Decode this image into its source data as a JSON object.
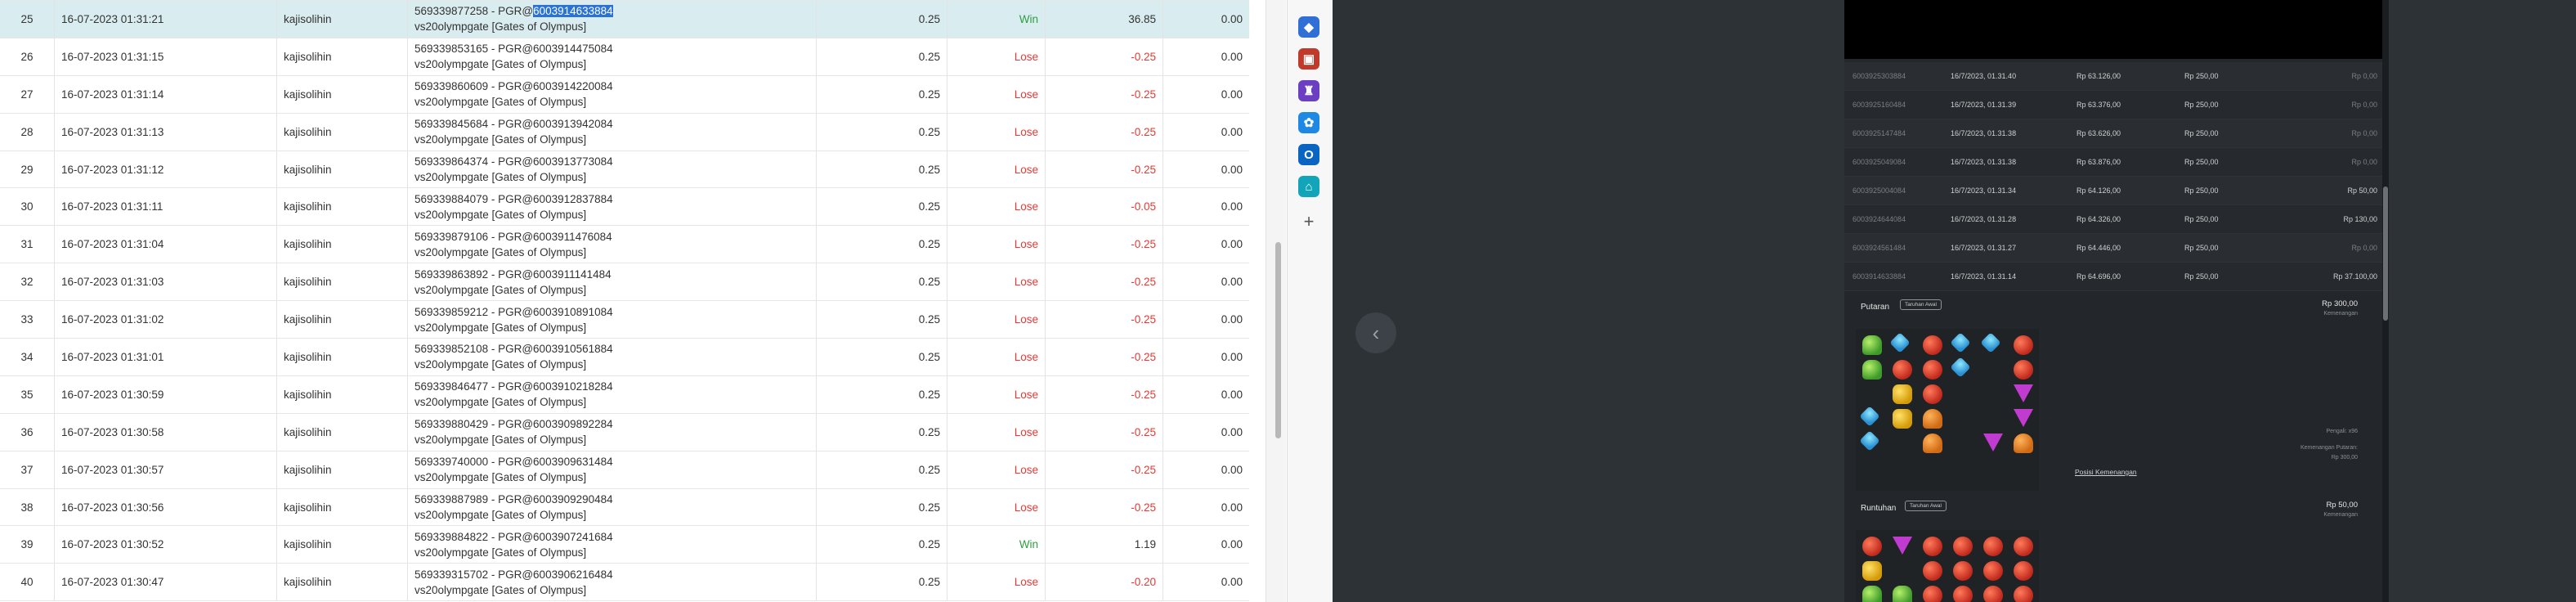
{
  "rows": [
    {
      "no": "25",
      "date": "16-07-2023 01:31:21",
      "user": "kajisolihin",
      "desc_a": "569339877258 - PGR@",
      "desc_sel": "6003914633884",
      "desc_b": "vs20olympgate [Gates of Olympus]",
      "bet": "0.25",
      "result": "Win",
      "winlose": "36.85",
      "balance": "0.00"
    },
    {
      "no": "26",
      "date": "16-07-2023 01:31:15",
      "user": "kajisolihin",
      "desc_a": "569339853165 - PGR@6003914475084",
      "desc_sel": "",
      "desc_b": "vs20olympgate [Gates of Olympus]",
      "bet": "0.25",
      "result": "Lose",
      "winlose": "-0.25",
      "balance": "0.00"
    },
    {
      "no": "27",
      "date": "16-07-2023 01:31:14",
      "user": "kajisolihin",
      "desc_a": "569339860609 - PGR@6003914220084",
      "desc_sel": "",
      "desc_b": "vs20olympgate [Gates of Olympus]",
      "bet": "0.25",
      "result": "Lose",
      "winlose": "-0.25",
      "balance": "0.00"
    },
    {
      "no": "28",
      "date": "16-07-2023 01:31:13",
      "user": "kajisolihin",
      "desc_a": "569339845684 - PGR@6003913942084",
      "desc_sel": "",
      "desc_b": "vs20olympgate [Gates of Olympus]",
      "bet": "0.25",
      "result": "Lose",
      "winlose": "-0.25",
      "balance": "0.00"
    },
    {
      "no": "29",
      "date": "16-07-2023 01:31:12",
      "user": "kajisolihin",
      "desc_a": "569339864374 - PGR@6003913773084",
      "desc_sel": "",
      "desc_b": "vs20olympgate [Gates of Olympus]",
      "bet": "0.25",
      "result": "Lose",
      "winlose": "-0.25",
      "balance": "0.00"
    },
    {
      "no": "30",
      "date": "16-07-2023 01:31:11",
      "user": "kajisolihin",
      "desc_a": "569339884079 - PGR@6003912837884",
      "desc_sel": "",
      "desc_b": "vs20olympgate [Gates of Olympus]",
      "bet": "0.25",
      "result": "Lose",
      "winlose": "-0.05",
      "balance": "0.00"
    },
    {
      "no": "31",
      "date": "16-07-2023 01:31:04",
      "user": "kajisolihin",
      "desc_a": "569339879106 - PGR@6003911476084",
      "desc_sel": "",
      "desc_b": "vs20olympgate [Gates of Olympus]",
      "bet": "0.25",
      "result": "Lose",
      "winlose": "-0.25",
      "balance": "0.00"
    },
    {
      "no": "32",
      "date": "16-07-2023 01:31:03",
      "user": "kajisolihin",
      "desc_a": "569339863892 - PGR@6003911141484",
      "desc_sel": "",
      "desc_b": "vs20olympgate [Gates of Olympus]",
      "bet": "0.25",
      "result": "Lose",
      "winlose": "-0.25",
      "balance": "0.00"
    },
    {
      "no": "33",
      "date": "16-07-2023 01:31:02",
      "user": "kajisolihin",
      "desc_a": "569339859212 - PGR@6003910891084",
      "desc_sel": "",
      "desc_b": "vs20olympgate [Gates of Olympus]",
      "bet": "0.25",
      "result": "Lose",
      "winlose": "-0.25",
      "balance": "0.00"
    },
    {
      "no": "34",
      "date": "16-07-2023 01:31:01",
      "user": "kajisolihin",
      "desc_a": "569339852108 - PGR@6003910561884",
      "desc_sel": "",
      "desc_b": "vs20olympgate [Gates of Olympus]",
      "bet": "0.25",
      "result": "Lose",
      "winlose": "-0.25",
      "balance": "0.00"
    },
    {
      "no": "35",
      "date": "16-07-2023 01:30:59",
      "user": "kajisolihin",
      "desc_a": "569339846477 - PGR@6003910218284",
      "desc_sel": "",
      "desc_b": "vs20olympgate [Gates of Olympus]",
      "bet": "0.25",
      "result": "Lose",
      "winlose": "-0.25",
      "balance": "0.00"
    },
    {
      "no": "36",
      "date": "16-07-2023 01:30:58",
      "user": "kajisolihin",
      "desc_a": "569339880429 - PGR@6003909892284",
      "desc_sel": "",
      "desc_b": "vs20olympgate [Gates of Olympus]",
      "bet": "0.25",
      "result": "Lose",
      "winlose": "-0.25",
      "balance": "0.00"
    },
    {
      "no": "37",
      "date": "16-07-2023 01:30:57",
      "user": "kajisolihin",
      "desc_a": "569339740000 - PGR@6003909631484",
      "desc_sel": "",
      "desc_b": "vs20olympgate [Gates of Olympus]",
      "bet": "0.25",
      "result": "Lose",
      "winlose": "-0.25",
      "balance": "0.00"
    },
    {
      "no": "38",
      "date": "16-07-2023 01:30:56",
      "user": "kajisolihin",
      "desc_a": "569339887989 - PGR@6003909290484",
      "desc_sel": "",
      "desc_b": "vs20olympgate [Gates of Olympus]",
      "bet": "0.25",
      "result": "Lose",
      "winlose": "-0.25",
      "balance": "0.00"
    },
    {
      "no": "39",
      "date": "16-07-2023 01:30:52",
      "user": "kajisolihin",
      "desc_a": "569339884822 - PGR@6003907241684",
      "desc_sel": "",
      "desc_b": "vs20olympgate [Gates of Olympus]",
      "bet": "0.25",
      "result": "Win",
      "winlose": "1.19",
      "balance": "0.00"
    },
    {
      "no": "40",
      "date": "16-07-2023 01:30:47",
      "user": "kajisolihin",
      "desc_a": "569339315702 - PGR@6003906216484",
      "desc_sel": "",
      "desc_b": "vs20olympgate [Gates of Olympus]",
      "bet": "0.25",
      "result": "Lose",
      "winlose": "-0.20",
      "balance": "0.00"
    }
  ],
  "sidebar": {
    "icons": [
      {
        "name": "tag-icon",
        "color": "#2f6fd6",
        "glyph": "◆"
      },
      {
        "name": "toolbox-icon",
        "color": "#c0392b",
        "glyph": "▣"
      },
      {
        "name": "chess-icon",
        "color": "#6a3fc2",
        "glyph": "♜"
      },
      {
        "name": "copilot-icon",
        "color": "#1e88e5",
        "glyph": "✿"
      },
      {
        "name": "outlook-icon",
        "color": "#0a64c2",
        "glyph": "O"
      },
      {
        "name": "cart-icon",
        "color": "#12a4b8",
        "glyph": "⌂"
      }
    ],
    "add_label": "+"
  },
  "back_glyph": "‹",
  "history": [
    {
      "id": "6003925303884",
      "date": "16/7/2023, 01.31.40",
      "balance": "Rp 63.126,00",
      "bet": "Rp 250,00",
      "win": "Rp 0,00"
    },
    {
      "id": "6003925160484",
      "date": "16/7/2023, 01.31.39",
      "balance": "Rp 63.376,00",
      "bet": "Rp 250,00",
      "win": "Rp 0,00"
    },
    {
      "id": "6003925147484",
      "date": "16/7/2023, 01.31.38",
      "balance": "Rp 63.626,00",
      "bet": "Rp 250,00",
      "win": "Rp 0,00"
    },
    {
      "id": "6003925049084",
      "date": "16/7/2023, 01.31.38",
      "balance": "Rp 63.876,00",
      "bet": "Rp 250,00",
      "win": "Rp 0,00"
    },
    {
      "id": "6003925004084",
      "date": "16/7/2023, 01.31.34",
      "balance": "Rp 64.126,00",
      "bet": "Rp 250,00",
      "win": "Rp 50,00"
    },
    {
      "id": "6003924644084",
      "date": "16/7/2023, 01.31.28",
      "balance": "Rp 64.326,00",
      "bet": "Rp 250,00",
      "win": "Rp 130,00"
    },
    {
      "id": "6003924561484",
      "date": "16/7/2023, 01.31.27",
      "balance": "Rp 64.446,00",
      "bet": "Rp 250,00",
      "win": "Rp 0,00"
    },
    {
      "id": "6003914633884",
      "date": "16/7/2023, 01.31.14",
      "balance": "Rp 64.696,00",
      "bet": "Rp 250,00",
      "win": "Rp 37.100,00"
    }
  ],
  "panel1": {
    "title": "Putaran",
    "badge": "Taruhan Awal",
    "amount": "Rp 300,00",
    "amount_sub": "Kemenangan",
    "side_a": "Pengali: x96",
    "side_b": "Kemenangan Putaran:",
    "side_c": "Rp 300,00",
    "link": "Posisi Kemenangan"
  },
  "panel2": {
    "title": "Runtuhan",
    "badge": "Taruhan Awal",
    "amount": "Rp 50,00",
    "amount_sub": "Kemenangan"
  }
}
